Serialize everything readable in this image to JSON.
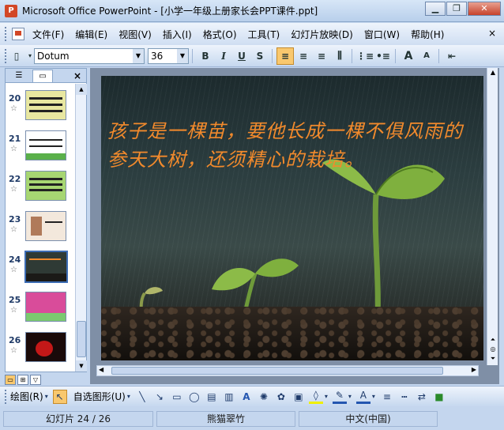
{
  "window": {
    "app_icon": "powerpoint-icon",
    "title": "Microsoft Office PowerPoint - [小学一年级上册家长会PPT课件.ppt]",
    "controls": [
      "minimize-icon",
      "restore-icon",
      "close-icon"
    ]
  },
  "menubar": {
    "items": [
      "文件(F)",
      "编辑(E)",
      "视图(V)",
      "插入(I)",
      "格式(O)",
      "工具(T)",
      "幻灯片放映(D)",
      "窗口(W)",
      "帮助(H)"
    ],
    "close_glyph": "×"
  },
  "toolbar": {
    "font_name": "Dotum",
    "font_size": "36",
    "bold": "B",
    "italic": "I",
    "underline": "U",
    "shadow": "S",
    "grow_font": "A",
    "shrink_font": "A"
  },
  "outline_pane": {
    "tabs": [
      "outline-tab",
      "slides-tab"
    ],
    "close_glyph": "×",
    "slides": [
      {
        "number": "20",
        "color": "#e8e7a0",
        "selected": false
      },
      {
        "number": "21",
        "color": "#ffffff",
        "selected": false
      },
      {
        "number": "22",
        "color": "#a7d672",
        "selected": false
      },
      {
        "number": "23",
        "color": "#f3e8dc",
        "selected": false
      },
      {
        "number": "24",
        "color": "#2f3a35",
        "selected": true
      },
      {
        "number": "25",
        "color": "#d94c9a",
        "selected": false
      },
      {
        "number": "26",
        "color": "#1a0a0a",
        "selected": false
      }
    ]
  },
  "slide": {
    "text": "孩子是一棵苗，要他长成一棵不俱风雨的参天大树，还须精心的栽培。",
    "text_color": "#f28a2c"
  },
  "drawing_toolbar": {
    "draw_label": "绘图(R)",
    "autoshapes_label": "自选图形(U)"
  },
  "statusbar": {
    "slide_position": "幻灯片 24 / 26",
    "design": "熊猫翠竹",
    "language": "中文(中国)"
  }
}
